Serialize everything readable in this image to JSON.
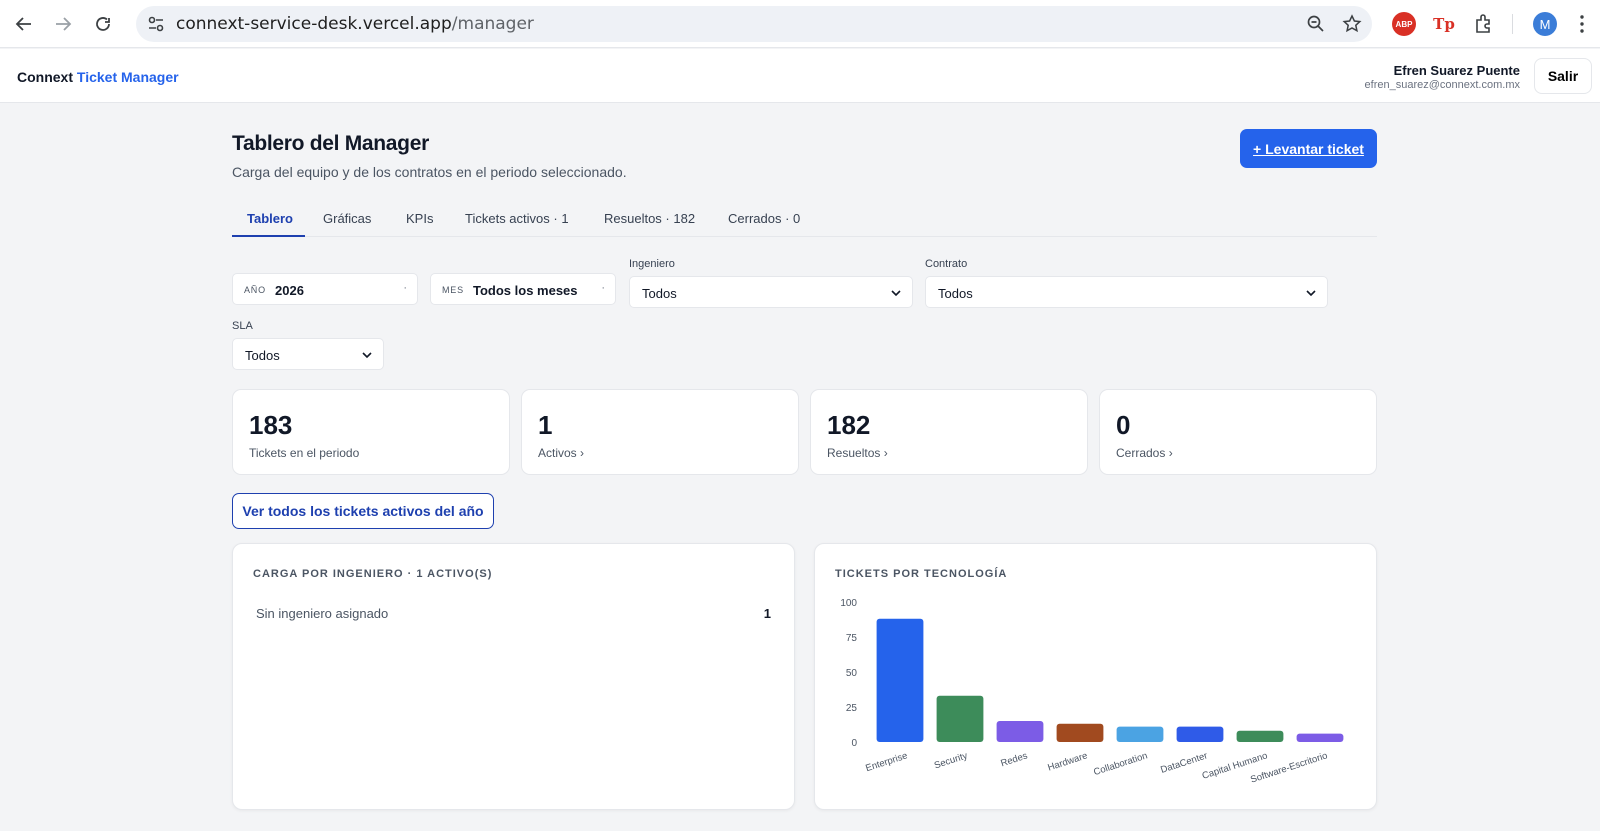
{
  "browser": {
    "url_host": "connext-service-desk.vercel.app",
    "url_path": "/manager",
    "ext_abp": "ABP",
    "ext_tp": "Tp",
    "avatar_letter": "M"
  },
  "header": {
    "brand_first": "Connext",
    "brand_accent": "Ticket Manager",
    "user_name": "Efren Suarez Puente",
    "user_email": "efren_suarez@connext.com.mx",
    "logout_label": "Salir"
  },
  "page": {
    "title": "Tablero del Manager",
    "subtitle": "Carga del equipo y de los contratos en el periodo seleccionado.",
    "cta_label": "+ Levantar ticket"
  },
  "tabs": [
    {
      "label": "Tablero"
    },
    {
      "label": "Gráficas"
    },
    {
      "label": "KPIs"
    },
    {
      "label": "Tickets activos · 1"
    },
    {
      "label": "Resueltos · 182"
    },
    {
      "label": "Cerrados · 0"
    }
  ],
  "filters": {
    "year": {
      "mini": "AÑO",
      "value": "2026"
    },
    "month": {
      "mini": "MES",
      "value": "Todos los meses"
    },
    "engineer": {
      "label": "Ingeniero",
      "value": "Todos"
    },
    "contract": {
      "label": "Contrato",
      "value": "Todos"
    },
    "sla": {
      "label": "SLA",
      "value": "Todos"
    }
  },
  "kpis": [
    {
      "value": "183",
      "label": "Tickets en el periodo"
    },
    {
      "value": "1",
      "label": "Activos ›"
    },
    {
      "value": "182",
      "label": "Resueltos ›"
    },
    {
      "value": "0",
      "label": "Cerrados ›"
    }
  ],
  "view_all_label": "Ver todos los tickets activos del año",
  "load_panel": {
    "title": "CARGA POR INGENIERO · 1 ACTIVO(S)",
    "rows": [
      {
        "label": "Sin ingeniero asignado",
        "value": "1"
      }
    ]
  },
  "chart_data": {
    "type": "bar",
    "title": "TICKETS POR TECNOLOGÍA",
    "categories": [
      "Enterprise",
      "Security",
      "Redes",
      "Hardware",
      "Collaboration",
      "DataCenter",
      "Capital Humano",
      "Software-Escritorio"
    ],
    "values": [
      88,
      33,
      15,
      13,
      11,
      11,
      8,
      6
    ],
    "colors": [
      "#2563eb",
      "#3d8c5a",
      "#7c5ce6",
      "#a14a1f",
      "#4ba3e3",
      "#2f5be8",
      "#3d8c5a",
      "#7c5ce6"
    ],
    "yticks": [
      0,
      25,
      50,
      75,
      100
    ],
    "ylim": [
      0,
      100
    ],
    "grid": false,
    "legend": "none"
  }
}
